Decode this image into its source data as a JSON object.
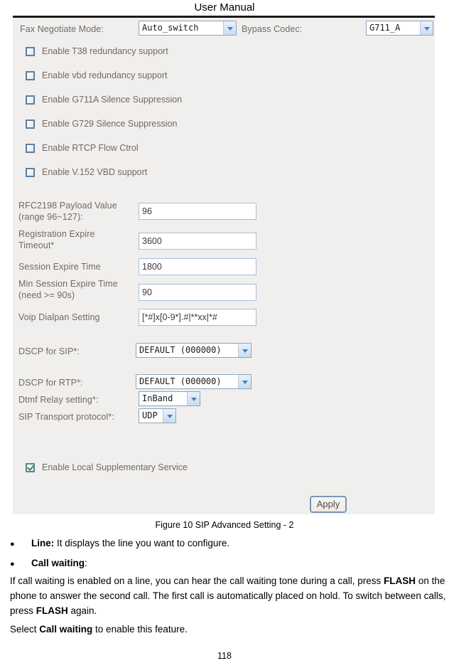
{
  "document": {
    "header_title": "User Manual",
    "page_number": "118",
    "figure_caption": "Figure 10 SIP Advanced Setting - 2"
  },
  "panel": {
    "fax_negotiate": {
      "label": "Fax Negotiate Mode:",
      "value": "Auto_switch"
    },
    "bypass_codec": {
      "label": "Bypass Codec:",
      "value": "G711_A"
    },
    "checkboxes": [
      {
        "label": "Enable T38 redundancy support",
        "checked": false
      },
      {
        "label": "Enable vbd redundancy support",
        "checked": false
      },
      {
        "label": "Enable G711A Silence Suppression",
        "checked": false
      },
      {
        "label": "Enable G729 Silence Suppression",
        "checked": false
      },
      {
        "label": "Enable RTCP Flow Ctrol",
        "checked": false
      },
      {
        "label": "Enable V.152 VBD support",
        "checked": false
      }
    ],
    "fields": [
      {
        "label": "RFC2198 Payload Value\n(range 96~127):",
        "value": "96"
      },
      {
        "label": "Registration Expire\nTimeout*",
        "value": "3600"
      },
      {
        "label": "Session Expire Time",
        "value": "1800"
      },
      {
        "label": "Min Session Expire Time\n(need >= 90s)",
        "value": "90"
      },
      {
        "label": "Voip Dialpan Setting",
        "value": "[*#]x[0-9*].#|**xx|*#"
      }
    ],
    "selects": [
      {
        "label": "DSCP for SIP*:",
        "value": "DEFAULT (000000)"
      },
      {
        "label": "DSCP for RTP*:",
        "value": "DEFAULT (000000)"
      },
      {
        "label": "Dtmf Relay setting*:",
        "value": "InBand"
      },
      {
        "label": "SIP Transport protocol*:",
        "value": "UDP"
      }
    ],
    "local_supplementary": {
      "label": "Enable Local Supplementary Service",
      "checked": true
    },
    "apply_label": "Apply"
  },
  "body": {
    "bullet_1_term": "Line:",
    "bullet_1_text": " It displays the line you want to configure.",
    "bullet_2_term": "Call waiting",
    "bullet_2_text": ":",
    "paragraph_1_a": "If call waiting is enabled on a line, you can hear the call waiting tone during a call, press ",
    "paragraph_1_b": "FLASH",
    "paragraph_1_c": " on the phone to answer the second call. The first call is automatically placed on hold. To switch between calls, press ",
    "paragraph_1_d": "FLASH",
    "paragraph_1_e": " again.",
    "paragraph_2_a": "Select ",
    "paragraph_2_b": "Call waiting",
    "paragraph_2_c": " to enable this feature."
  }
}
